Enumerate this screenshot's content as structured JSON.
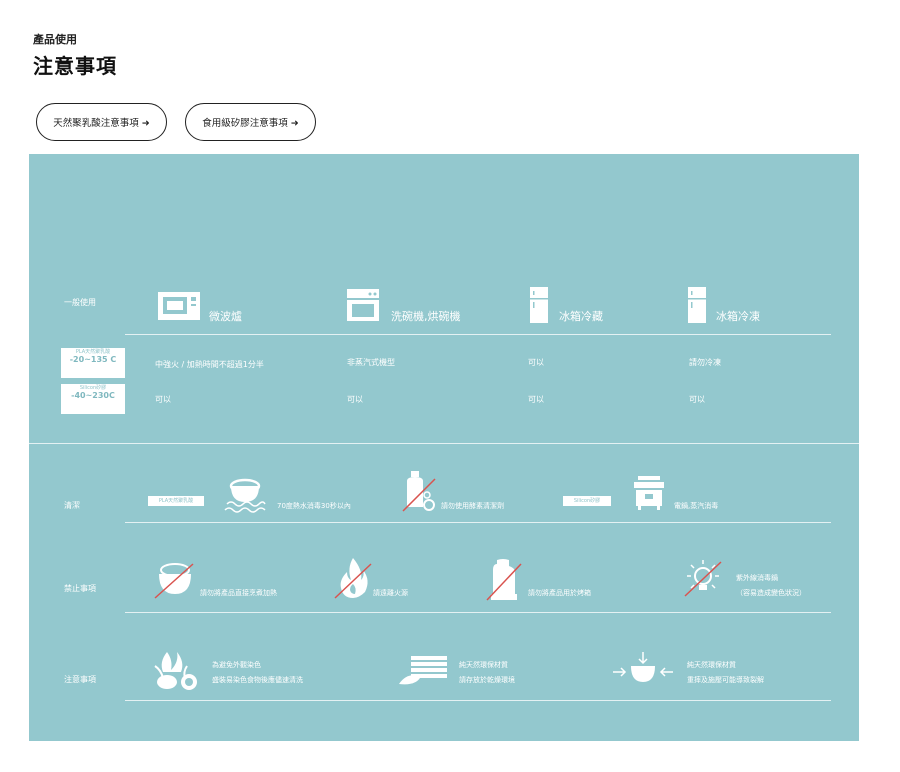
{
  "header": {
    "subtitle": "產品使用",
    "title": "注意事項"
  },
  "buttons": [
    {
      "label": "天然聚乳酸注意事項 ➜"
    },
    {
      "label": "食用級矽膠注意事項 ➜"
    }
  ],
  "general": {
    "label": "一般使用",
    "columns": [
      "微波爐",
      "洗碗機,烘碗機",
      "冰箱冷藏",
      "冰箱冷凍"
    ],
    "materials": [
      {
        "name": "PLA天然聚乳酸",
        "temp": "-20~135 C",
        "values": [
          "中強火 / 加熱時間不超過1分半",
          "非蒸汽式機型",
          "可以",
          "請勿冷凍"
        ]
      },
      {
        "name": "Silicon矽膠",
        "temp": "-40~230C",
        "values": [
          "可以",
          "可以",
          "可以",
          "可以"
        ]
      }
    ]
  },
  "cleaning": {
    "label": "清潔",
    "pla_tag": "PLA天然聚乳酸",
    "pla_note": "70度熱水消毒30秒以內",
    "detergent_note": "請勿使用酵素清潔劑",
    "silicon_tag": "Silicon矽膠",
    "silicon_note": "電鍋,蒸汽消毒"
  },
  "prohibited": {
    "label": "禁止事項",
    "items": [
      "請勿將產品直接烹煮加熱",
      "請遠離火源",
      "請勿將產品用於烤箱"
    ],
    "uv_line1": "紫外線消毒鍋",
    "uv_line2": "（容易造成變色狀況）"
  },
  "notes": {
    "label": "注意事項",
    "n1_line1": "為避免外觀染色",
    "n1_line2": "盛裝易染色食物後應儘速清洗",
    "n2_line1": "純天然環保材質",
    "n2_line2": "請存放於乾燥環境",
    "n3_line1": "純天然環保材質",
    "n3_line2": "重摔及施壓可能導致裂解"
  },
  "colors": {
    "panel": "#93c8ce",
    "slash": "#d9534f"
  }
}
